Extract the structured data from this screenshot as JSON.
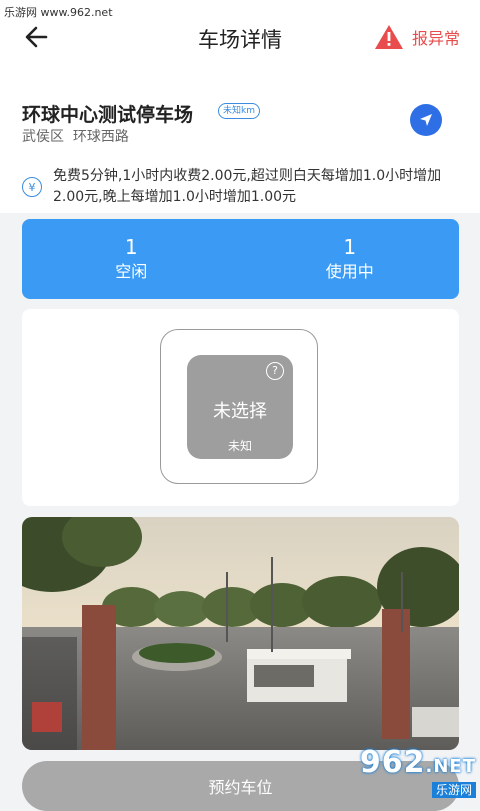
{
  "watermark": {
    "text": "乐游网 www.962.net"
  },
  "header": {
    "title": "车场详情",
    "report_label": "报异常"
  },
  "lot": {
    "name": "环球中心测试停车场",
    "distance_badge": "未知km",
    "district": "武侯区",
    "street": "环球西路"
  },
  "fee": {
    "icon_symbol": "¥",
    "description": "免费5分钟,1小时内收费2.00元,超过则白天每增加1.0小时增加2.00元,晚上每增加1.0小时增加1.00元"
  },
  "stats": {
    "idle": {
      "count": "1",
      "label": "空闲"
    },
    "in_use": {
      "count": "1",
      "label": "使用中"
    }
  },
  "space": {
    "status": "未选择",
    "sub": "未知",
    "help_symbol": "?"
  },
  "actions": {
    "reserve_label": "预约车位"
  },
  "brand": {
    "number": "962",
    "tld": ".NET",
    "name": "乐游网"
  },
  "colors": {
    "accent_blue": "#3b9bf4",
    "nav_blue": "#2f6fe6",
    "report_red": "#e84c4c",
    "disabled_gray": "#a9a9a9"
  },
  "icons": {
    "back": "arrow-left-icon",
    "report": "warning-triangle-icon",
    "navigate": "navigation-arrow-icon",
    "fee": "yen-circle-icon",
    "help": "question-circle-icon"
  }
}
